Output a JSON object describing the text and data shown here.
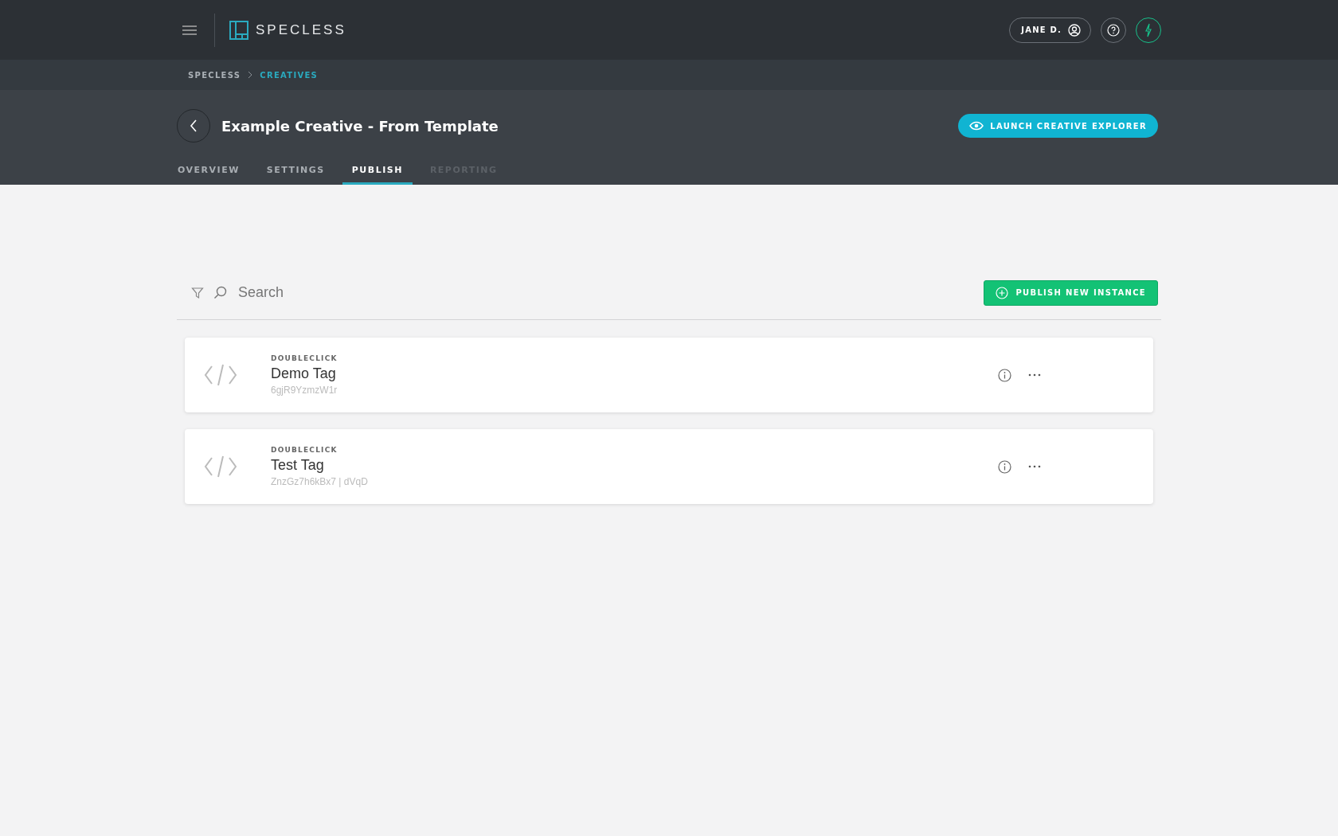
{
  "brand": "SPECLESS",
  "user": {
    "name": "JANE D."
  },
  "breadcrumb": [
    {
      "label": "SPECLESS",
      "selected": false
    },
    {
      "label": "CREATIVES",
      "selected": true
    }
  ],
  "page": {
    "title": "Example Creative - From Template",
    "action": "LAUNCH CREATIVE EXPLORER"
  },
  "tabs": [
    {
      "label": "OVERVIEW",
      "selected": false,
      "disabled": false
    },
    {
      "label": "SETTINGS",
      "selected": false,
      "disabled": false
    },
    {
      "label": "PUBLISH",
      "selected": true,
      "disabled": false
    },
    {
      "label": "REPORTING",
      "selected": false,
      "disabled": true
    }
  ],
  "search": {
    "placeholder": "Search"
  },
  "publish_button": "PUBLISH NEW INSTANCE",
  "instances": [
    {
      "platform": "DOUBLECLICK",
      "name": "Demo Tag",
      "id": "6gjR9YzmzW1r"
    },
    {
      "platform": "DOUBLECLICK",
      "name": "Test Tag",
      "id": "ZnzGz7h6kBx7 | dVqD"
    }
  ]
}
